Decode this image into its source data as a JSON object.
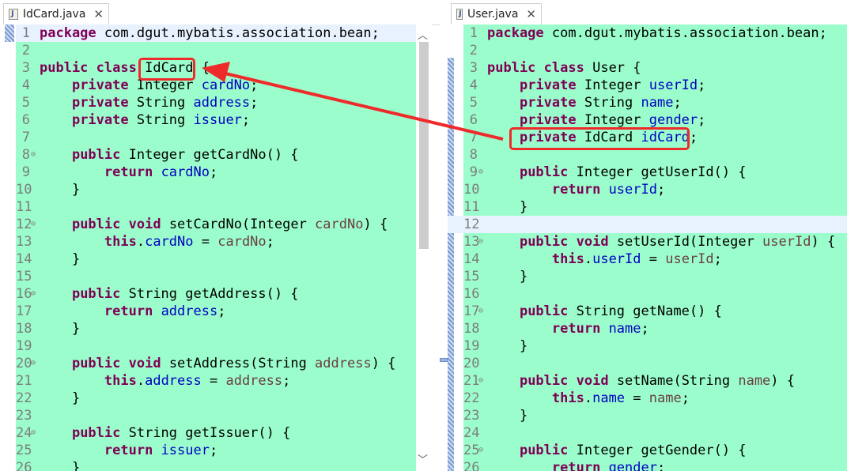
{
  "left": {
    "tab_title": "IdCard.java",
    "tab_close": "✕",
    "lines": [
      [
        {
          "t": "package",
          "c": "kw"
        },
        {
          "t": " com.dgut.mybatis.association.bean;"
        }
      ],
      [],
      [
        {
          "t": "public",
          "c": "kw"
        },
        {
          "t": " "
        },
        {
          "t": "class",
          "c": "kw"
        },
        {
          "t": " IdCard {"
        }
      ],
      [
        {
          "t": "    "
        },
        {
          "t": "private",
          "c": "kw"
        },
        {
          "t": " Integer "
        },
        {
          "t": "cardNo",
          "c": "fld"
        },
        {
          "t": ";"
        }
      ],
      [
        {
          "t": "    "
        },
        {
          "t": "private",
          "c": "kw"
        },
        {
          "t": " String "
        },
        {
          "t": "address",
          "c": "fld"
        },
        {
          "t": ";"
        }
      ],
      [
        {
          "t": "    "
        },
        {
          "t": "private",
          "c": "kw"
        },
        {
          "t": " String "
        },
        {
          "t": "issuer",
          "c": "fld"
        },
        {
          "t": ";"
        }
      ],
      [],
      [
        {
          "t": "    "
        },
        {
          "t": "public",
          "c": "kw"
        },
        {
          "t": " Integer getCardNo() {"
        }
      ],
      [
        {
          "t": "        "
        },
        {
          "t": "return",
          "c": "kw"
        },
        {
          "t": " "
        },
        {
          "t": "cardNo",
          "c": "fld"
        },
        {
          "t": ";"
        }
      ],
      [
        {
          "t": "    }"
        }
      ],
      [],
      [
        {
          "t": "    "
        },
        {
          "t": "public",
          "c": "kw"
        },
        {
          "t": " "
        },
        {
          "t": "void",
          "c": "kw"
        },
        {
          "t": " setCardNo(Integer "
        },
        {
          "t": "cardNo",
          "c": "par"
        },
        {
          "t": ") {"
        }
      ],
      [
        {
          "t": "        "
        },
        {
          "t": "this",
          "c": "kw"
        },
        {
          "t": "."
        },
        {
          "t": "cardNo",
          "c": "fld"
        },
        {
          "t": " = "
        },
        {
          "t": "cardNo",
          "c": "par"
        },
        {
          "t": ";"
        }
      ],
      [
        {
          "t": "    }"
        }
      ],
      [],
      [
        {
          "t": "    "
        },
        {
          "t": "public",
          "c": "kw"
        },
        {
          "t": " String getAddress() {"
        }
      ],
      [
        {
          "t": "        "
        },
        {
          "t": "return",
          "c": "kw"
        },
        {
          "t": " "
        },
        {
          "t": "address",
          "c": "fld"
        },
        {
          "t": ";"
        }
      ],
      [
        {
          "t": "    }"
        }
      ],
      [],
      [
        {
          "t": "    "
        },
        {
          "t": "public",
          "c": "kw"
        },
        {
          "t": " "
        },
        {
          "t": "void",
          "c": "kw"
        },
        {
          "t": " setAddress(String "
        },
        {
          "t": "address",
          "c": "par"
        },
        {
          "t": ") {"
        }
      ],
      [
        {
          "t": "        "
        },
        {
          "t": "this",
          "c": "kw"
        },
        {
          "t": "."
        },
        {
          "t": "address",
          "c": "fld"
        },
        {
          "t": " = "
        },
        {
          "t": "address",
          "c": "par"
        },
        {
          "t": ";"
        }
      ],
      [
        {
          "t": "    }"
        }
      ],
      [],
      [
        {
          "t": "    "
        },
        {
          "t": "public",
          "c": "kw"
        },
        {
          "t": " String getIssuer() {"
        }
      ],
      [
        {
          "t": "        "
        },
        {
          "t": "return",
          "c": "kw"
        },
        {
          "t": " "
        },
        {
          "t": "issuer",
          "c": "fld"
        },
        {
          "t": ";"
        }
      ],
      [
        {
          "t": "    }"
        }
      ]
    ],
    "fold_lines": [
      8,
      12,
      16,
      20,
      24
    ]
  },
  "right": {
    "tab_title": "User.java",
    "tab_close": "✕",
    "lines": [
      [
        {
          "t": "package",
          "c": "kw"
        },
        {
          "t": " com.dgut.mybatis.association.bean;"
        }
      ],
      [],
      [
        {
          "t": "public",
          "c": "kw"
        },
        {
          "t": " "
        },
        {
          "t": "class",
          "c": "kw"
        },
        {
          "t": " User {"
        }
      ],
      [
        {
          "t": "    "
        },
        {
          "t": "private",
          "c": "kw"
        },
        {
          "t": " Integer "
        },
        {
          "t": "userId",
          "c": "fld"
        },
        {
          "t": ";"
        }
      ],
      [
        {
          "t": "    "
        },
        {
          "t": "private",
          "c": "kw"
        },
        {
          "t": " String "
        },
        {
          "t": "name",
          "c": "fld"
        },
        {
          "t": ";"
        }
      ],
      [
        {
          "t": "    "
        },
        {
          "t": "private",
          "c": "kw"
        },
        {
          "t": " Integer "
        },
        {
          "t": "gender",
          "c": "fld"
        },
        {
          "t": ";"
        }
      ],
      [
        {
          "t": "    "
        },
        {
          "t": "private",
          "c": "kw"
        },
        {
          "t": " IdCard "
        },
        {
          "t": "idCard",
          "c": "fld"
        },
        {
          "t": ";"
        }
      ],
      [],
      [
        {
          "t": "    "
        },
        {
          "t": "public",
          "c": "kw"
        },
        {
          "t": " Integer getUserId() {"
        }
      ],
      [
        {
          "t": "        "
        },
        {
          "t": "return",
          "c": "kw"
        },
        {
          "t": " "
        },
        {
          "t": "userId",
          "c": "fld"
        },
        {
          "t": ";"
        }
      ],
      [
        {
          "t": "    }"
        }
      ],
      [],
      [
        {
          "t": "    "
        },
        {
          "t": "public",
          "c": "kw"
        },
        {
          "t": " "
        },
        {
          "t": "void",
          "c": "kw"
        },
        {
          "t": " setUserId(Integer "
        },
        {
          "t": "userId",
          "c": "par"
        },
        {
          "t": ") {"
        }
      ],
      [
        {
          "t": "        "
        },
        {
          "t": "this",
          "c": "kw"
        },
        {
          "t": "."
        },
        {
          "t": "userId",
          "c": "fld"
        },
        {
          "t": " = "
        },
        {
          "t": "userId",
          "c": "par"
        },
        {
          "t": ";"
        }
      ],
      [
        {
          "t": "    }"
        }
      ],
      [],
      [
        {
          "t": "    "
        },
        {
          "t": "public",
          "c": "kw"
        },
        {
          "t": " String getName() {"
        }
      ],
      [
        {
          "t": "        "
        },
        {
          "t": "return",
          "c": "kw"
        },
        {
          "t": " "
        },
        {
          "t": "name",
          "c": "fld"
        },
        {
          "t": ";"
        }
      ],
      [
        {
          "t": "    }"
        }
      ],
      [],
      [
        {
          "t": "    "
        },
        {
          "t": "public",
          "c": "kw"
        },
        {
          "t": " "
        },
        {
          "t": "void",
          "c": "kw"
        },
        {
          "t": " setName(String "
        },
        {
          "t": "name",
          "c": "par"
        },
        {
          "t": ") {"
        }
      ],
      [
        {
          "t": "        "
        },
        {
          "t": "this",
          "c": "kw"
        },
        {
          "t": "."
        },
        {
          "t": "name",
          "c": "fld"
        },
        {
          "t": " = "
        },
        {
          "t": "name",
          "c": "par"
        },
        {
          "t": ";"
        }
      ],
      [
        {
          "t": "    }"
        }
      ],
      [],
      [
        {
          "t": "    "
        },
        {
          "t": "public",
          "c": "kw"
        },
        {
          "t": " Integer getGender() {"
        }
      ],
      [
        {
          "t": "        "
        },
        {
          "t": "return",
          "c": "kw"
        },
        {
          "t": " "
        },
        {
          "t": "gender",
          "c": "fld"
        },
        {
          "t": ";"
        }
      ]
    ],
    "fold_lines": [
      9,
      13,
      17,
      21,
      25
    ]
  },
  "colors": {
    "editor_bg": "#9bfdcc",
    "keyword": "#7f0055",
    "field": "#0000c0",
    "parameter": "#6a3e3e",
    "annotation": "#ef2a2a"
  },
  "icons": {
    "file": "java-file-icon",
    "fold": "fold-collapse-icon"
  }
}
